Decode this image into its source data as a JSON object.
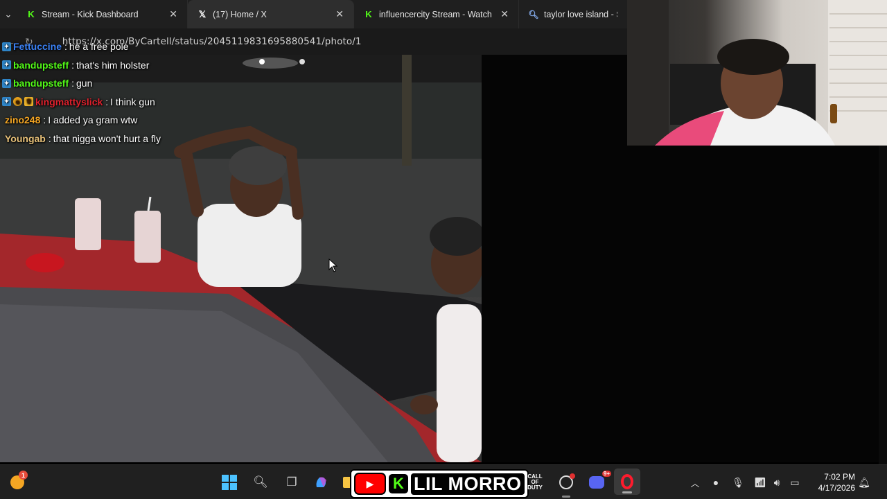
{
  "browser": {
    "tabs": [
      {
        "title": "Stream - Kick Dashboard",
        "icon": "kick-icon",
        "active": false
      },
      {
        "title": "(17) Home / X",
        "icon": "x-icon",
        "active": true
      },
      {
        "title": "influencercity Stream - Watch Live",
        "icon": "kick-icon",
        "active": false
      },
      {
        "title": "taylor love island - Sear",
        "icon": "search-icon",
        "active": false
      }
    ],
    "url": "https://x.com/ByCartell/status/2045119831695880541/photo/1"
  },
  "chat": {
    "messages": [
      {
        "user": "Fettuccine",
        "text": "he a free pole",
        "color": "#3b82f6",
        "badges": [
          "sub"
        ]
      },
      {
        "user": "bandupsteff",
        "text": "that's him holster",
        "color": "#53fc18",
        "badges": [
          "sub"
        ]
      },
      {
        "user": "bandupsteff",
        "text": "gun",
        "color": "#53fc18",
        "badges": [
          "sub"
        ]
      },
      {
        "user": "kingmattyslick",
        "text": "I think gun",
        "color": "#e0202c",
        "badges": [
          "sub",
          "og",
          "crown"
        ]
      },
      {
        "user": "zino248",
        "text": "I added ya gram wtw",
        "color": "#f5a623",
        "badges": []
      },
      {
        "user": "Youngab",
        "text": "that nigga won't hurt a fly",
        "color": "#e8c27a",
        "badges": []
      }
    ]
  },
  "taskbar": {
    "banner_name": "LIL MORRO",
    "cod_label": "CALL OF DUTY",
    "weather_badge": "1",
    "discord_badge": "9+",
    "time": "7:02 PM",
    "date": "4/17/2026"
  },
  "colors": {
    "kick_green": "#53fc18",
    "accent_blue": "#4cc2ff",
    "opera_red": "#ff1b2d"
  }
}
